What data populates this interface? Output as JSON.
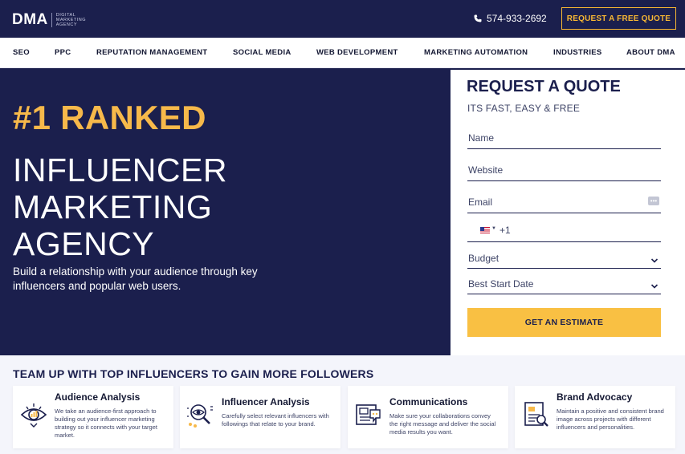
{
  "header": {
    "logo": "DMA",
    "logo_sub": "DIGITAL MARKETING AGENCY",
    "phone": "574-933-2692",
    "quote_button": "REQUEST A FREE QUOTE"
  },
  "nav": {
    "items": [
      "SEO",
      "PPC",
      "REPUTATION MANAGEMENT",
      "SOCIAL MEDIA",
      "WEB DEVELOPMENT",
      "MARKETING AUTOMATION",
      "INDUSTRIES",
      "ABOUT DMA"
    ]
  },
  "hero": {
    "rank": "#1 RANKED",
    "title_lines": [
      "INFLUENCER",
      "MARKETING",
      "AGENCY"
    ],
    "description": "Build a relationship with your audience through key influencers and popular web users."
  },
  "form": {
    "title": "REQUEST A QUOTE",
    "subtitle": "ITS FAST, EASY & FREE",
    "name_placeholder": "Name",
    "website_placeholder": "Website",
    "email_placeholder": "Email",
    "phone_code": "+1",
    "budget_label": "Budget",
    "start_date_label": "Best Start Date",
    "submit": "GET AN ESTIMATE"
  },
  "section": {
    "title": "TEAM UP WITH TOP INFLUENCERS TO GAIN MORE FOLLOWERS",
    "cards": [
      {
        "title": "Audience Analysis",
        "desc": "We take an audience-first approach to building out your influencer marketing strategy so it connects with your target market.",
        "icon": "audience-eye-icon"
      },
      {
        "title": "Influencer Analysis",
        "desc": "Carefully select relevant influencers with followings that relate to your brand.",
        "icon": "influencer-search-icon"
      },
      {
        "title": "Communications",
        "desc": "Make sure your collaborations convey the right message and deliver the social media results you want.",
        "icon": "communications-icon"
      },
      {
        "title": "Brand Advocacy",
        "desc": "Maintain a positive and consistent brand image across projects with different influencers and personalities.",
        "icon": "brand-document-icon"
      }
    ]
  },
  "colors": {
    "navy": "#1b1f4d",
    "accent": "#f7b94a",
    "button_yellow": "#f9c043"
  }
}
